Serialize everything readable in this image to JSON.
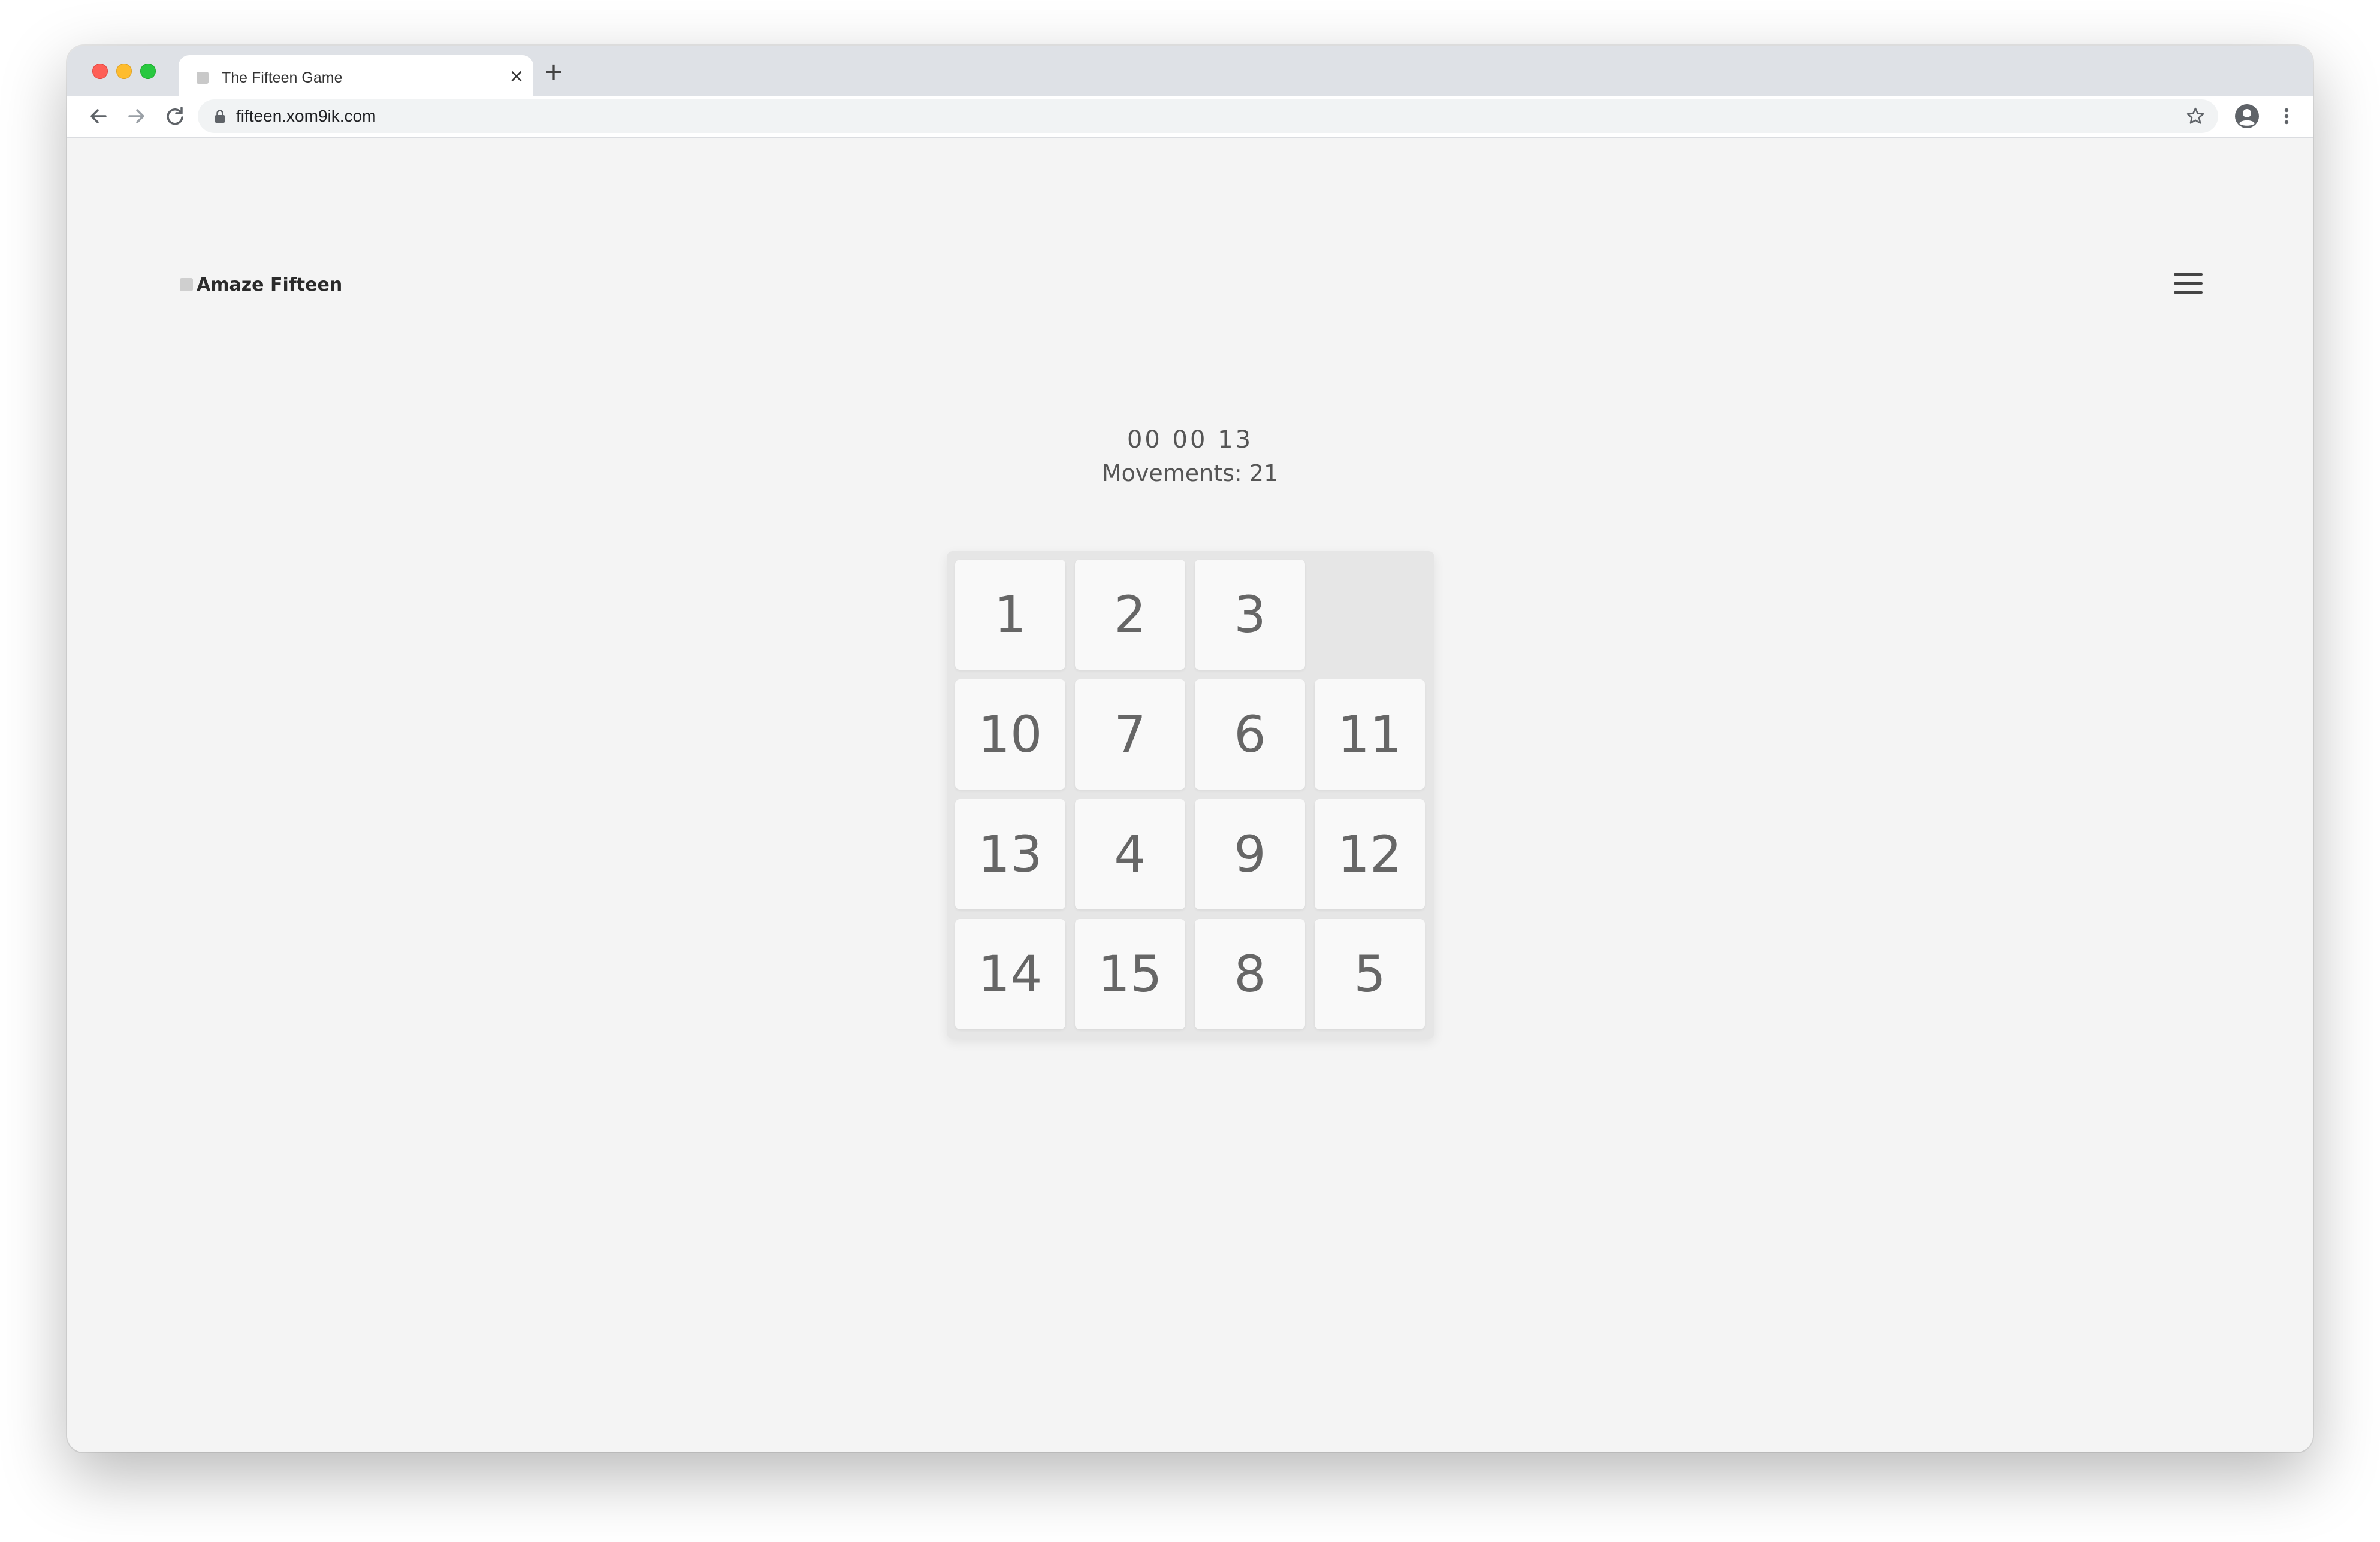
{
  "browser": {
    "tab_title": "The Fifteen Game",
    "tab_close": "×",
    "new_tab": "+",
    "url": "fifteen.xom9ik.com"
  },
  "header": {
    "brand": "Amaze Fifteen"
  },
  "game": {
    "timer": "00 00 13",
    "movements": "Movements: 21",
    "tiles": [
      "1",
      "2",
      "3",
      "",
      "10",
      "7",
      "6",
      "11",
      "13",
      "4",
      "9",
      "12",
      "14",
      "15",
      "8",
      "5"
    ]
  },
  "colors": {
    "page_background": "#f4f4f4",
    "tile_background": "#f9f9f9",
    "board_background": "#e6e6e6",
    "tile_text": "#666666"
  },
  "icons": {
    "back": "arrow-left-icon",
    "forward": "arrow-right-icon",
    "reload": "reload-icon",
    "lock": "lock-icon",
    "bookmark": "star-icon",
    "profile": "account-circle-icon",
    "menu": "vertical-dots-icon",
    "site_menu": "hamburger-icon"
  }
}
